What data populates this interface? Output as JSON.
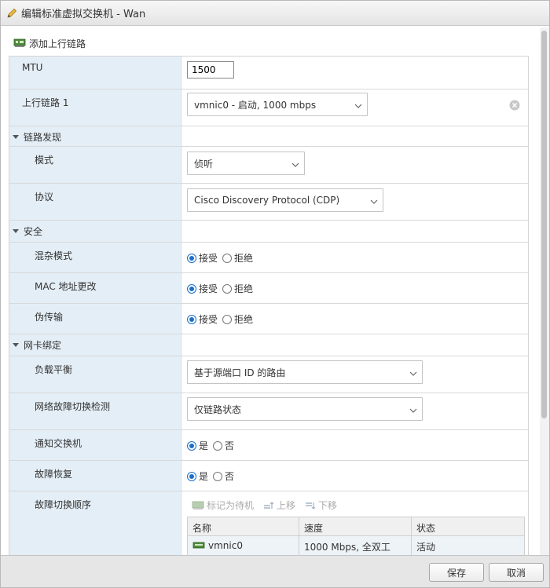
{
  "window": {
    "title": "编辑标准虚拟交换机 - Wan"
  },
  "toolbar": {
    "add_uplink_label": "添加上行链路"
  },
  "fields": {
    "mtu": {
      "label": "MTU",
      "value": "1500"
    },
    "uplink1": {
      "label": "上行链路 1",
      "value": "vmnic0 - 启动, 1000 mbps"
    }
  },
  "sections": {
    "link_discovery": {
      "label": "链路发现",
      "mode": {
        "label": "模式",
        "value": "侦听"
      },
      "protocol": {
        "label": "协议",
        "value": "Cisco Discovery Protocol (CDP)"
      }
    },
    "security": {
      "label": "安全",
      "promiscuous": {
        "label": "混杂模式",
        "accept": "接受",
        "reject": "拒绝",
        "selected": "accept"
      },
      "mac_change": {
        "label": "MAC 地址更改",
        "accept": "接受",
        "reject": "拒绝",
        "selected": "accept"
      },
      "forged": {
        "label": "伪传输",
        "accept": "接受",
        "reject": "拒绝",
        "selected": "accept"
      }
    },
    "teaming": {
      "label": "网卡绑定",
      "load_balancing": {
        "label": "负载平衡",
        "value": "基于源端口 ID 的路由"
      },
      "failure_detection": {
        "label": "网络故障切换检测",
        "value": "仅链路状态"
      },
      "notify_switches": {
        "label": "通知交换机",
        "yes": "是",
        "no": "否",
        "selected": "yes"
      },
      "failback": {
        "label": "故障恢复",
        "yes": "是",
        "no": "否",
        "selected": "yes"
      },
      "failover_order": {
        "label": "故障切换顺序",
        "actions": {
          "mark_standby": "标记为待机",
          "move_up": "上移",
          "move_down": "下移"
        },
        "columns": [
          "名称",
          "速度",
          "状态"
        ],
        "rows": [
          {
            "name": "vmnic0",
            "speed": "1000 Mbps, 全双工",
            "status": "活动"
          }
        ]
      }
    }
  },
  "footer": {
    "save": "保存",
    "cancel": "取消"
  },
  "colors": {
    "accent": "#1a6fc9",
    "label_bg": "#e4eef6",
    "footer_bg": "#e6e6e6"
  }
}
